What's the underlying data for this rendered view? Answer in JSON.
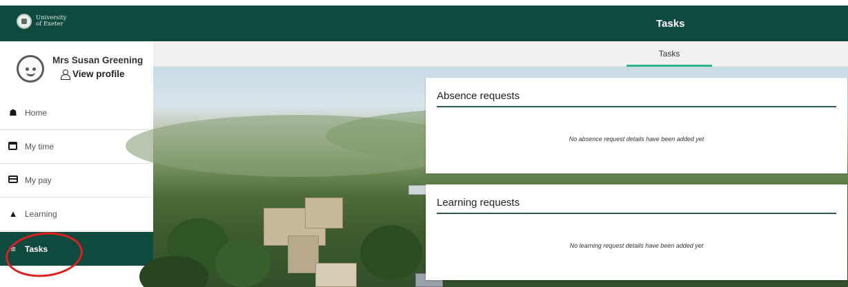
{
  "header": {
    "title": "Tasks",
    "logo_text_1": "University",
    "logo_text_2": "of Exeter"
  },
  "profile": {
    "name": "Mrs Susan Greening",
    "link_label": "View profile"
  },
  "sidebar": {
    "items": [
      {
        "label": "Home",
        "icon": "home-icon"
      },
      {
        "label": "My time",
        "icon": "calendar-icon"
      },
      {
        "label": "My pay",
        "icon": "card-icon"
      },
      {
        "label": "Learning",
        "icon": "graduation-cap-icon"
      },
      {
        "label": "Tasks",
        "icon": "tasks-icon",
        "active": true
      }
    ]
  },
  "tabs": [
    {
      "label": "Tasks",
      "active": true
    }
  ],
  "panels": {
    "absence": {
      "title": "Absence requests",
      "empty": "No absence request details have been added yet"
    },
    "learning": {
      "title": "Learning requests",
      "empty": "No learning request details have been added yet"
    }
  },
  "colors": {
    "brand": "#0f4a3e",
    "tab_underline": "#2bb58a",
    "highlight_circle": "#e11d1d"
  }
}
